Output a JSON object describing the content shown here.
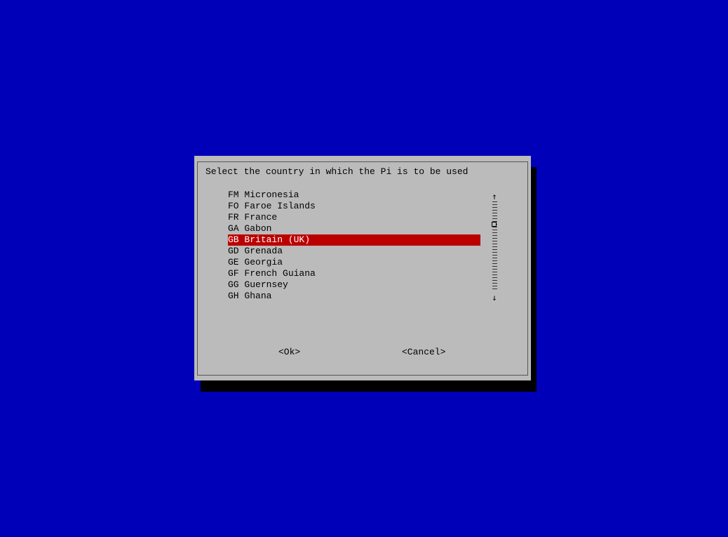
{
  "dialog": {
    "prompt": "Select the country in which the Pi is to be used",
    "items": [
      {
        "code": "FM",
        "name": "Micronesia",
        "selected": false
      },
      {
        "code": "FO",
        "name": "Faroe Islands",
        "selected": false
      },
      {
        "code": "FR",
        "name": "France",
        "selected": false
      },
      {
        "code": "GA",
        "name": "Gabon",
        "selected": false
      },
      {
        "code": "GB",
        "name": "Britain (UK)",
        "selected": true
      },
      {
        "code": "GD",
        "name": "Grenada",
        "selected": false
      },
      {
        "code": "GE",
        "name": "Georgia",
        "selected": false
      },
      {
        "code": "GF",
        "name": "French Guiana",
        "selected": false
      },
      {
        "code": "GG",
        "name": "Guernsey",
        "selected": false
      },
      {
        "code": "GH",
        "name": "Ghana",
        "selected": false
      }
    ],
    "scrollbar": {
      "up_arrow": "↑",
      "down_arrow": "↓"
    },
    "buttons": {
      "ok_label": "<Ok>",
      "cancel_label": "<Cancel>"
    }
  },
  "colors": {
    "background": "#0000b8",
    "dialog": "#bbbbbb",
    "selection": "#bb0000",
    "selection_text": "#ffffff"
  }
}
